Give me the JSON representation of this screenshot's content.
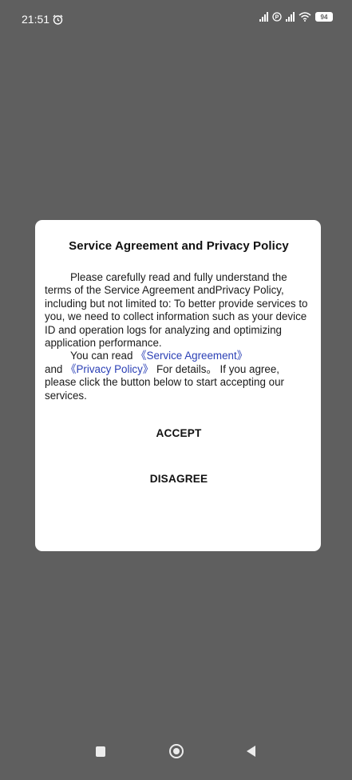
{
  "status_bar": {
    "time": "21:51",
    "alarm_icon": "alarm-clock-icon",
    "battery_level": "94",
    "icons": [
      "signal-icon",
      "data-saver-icon",
      "signal-icon",
      "wifi-icon",
      "battery-icon"
    ]
  },
  "dialog": {
    "title": "Service Agreement and Privacy Policy",
    "paragraph1": "Please carefully read and fully understand the terms of the Service Agreement andPrivacy Policy, including but not limited to: To better provide services to you, we need to collect information such as your device ID and operation logs for analyzing and optimizing application performance.",
    "read_prefix": "You can read",
    "service_agreement_link": "《Service Agreement》",
    "and_text": "and",
    "privacy_policy_link": "《Privacy Policy》",
    "details_text": "For details。 If you agree, please click the button below to start accepting our services.",
    "accept_label": "ACCEPT",
    "disagree_label": "DISAGREE"
  },
  "nav_bar": {
    "icons": [
      "recent-apps-icon",
      "home-icon",
      "back-icon"
    ]
  },
  "colors": {
    "overlay": "#5f5f5f",
    "link": "#2a3fb5",
    "dialog_bg": "#ffffff"
  }
}
